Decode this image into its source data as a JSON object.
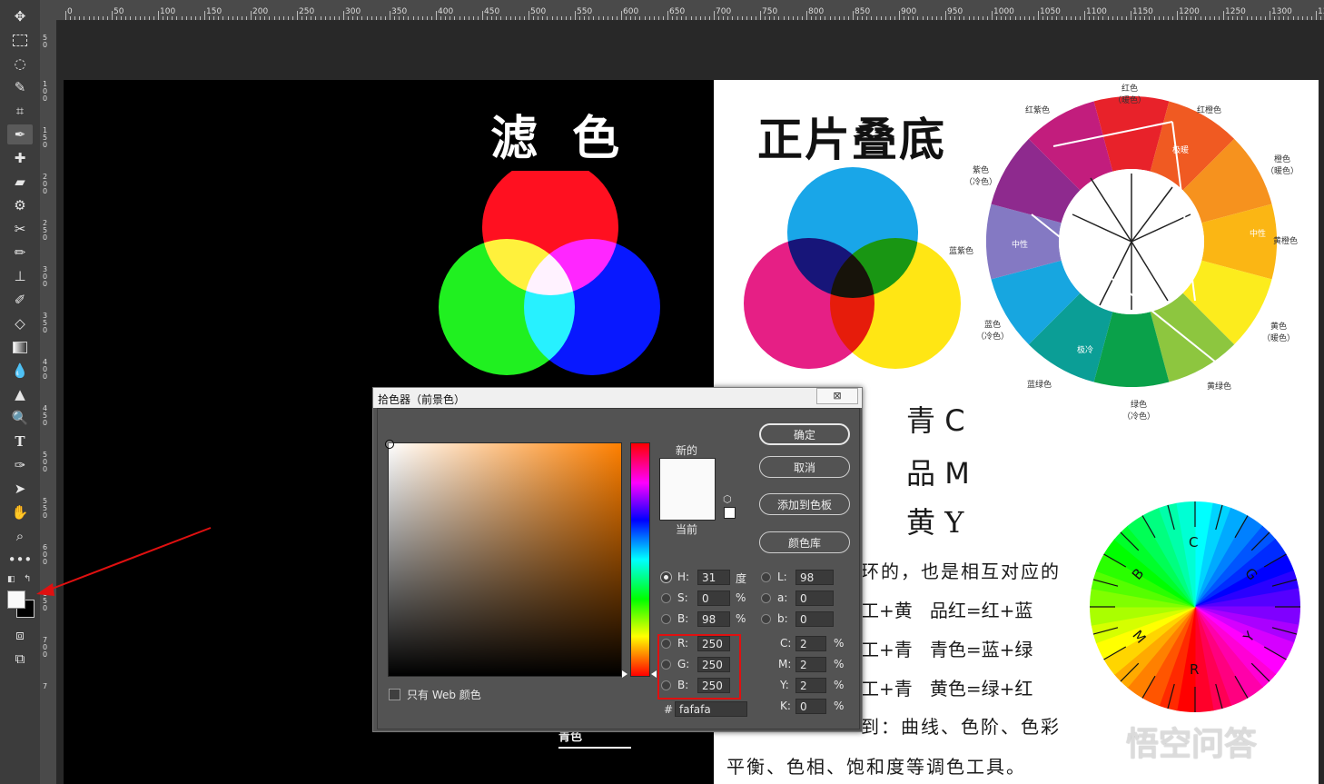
{
  "ruler": {
    "h_labels": [
      "0",
      "50",
      "100",
      "150",
      "200",
      "250",
      "300",
      "350",
      "400",
      "450",
      "500",
      "550",
      "600",
      "650",
      "700",
      "750",
      "800",
      "850",
      "900",
      "950",
      "1000",
      "1050",
      "1100",
      "1150",
      "1200",
      "1250",
      "1300",
      "13"
    ],
    "v_labels": [
      "5 0",
      "1 0 0",
      "1 5 0",
      "2 0 0",
      "2 5 0",
      "3 0 0",
      "3 5 0",
      "4 0 0",
      "4 5 0",
      "5 0 0",
      "5 5 0",
      "6 0 0",
      "6 5 0",
      "7 0 0",
      "7"
    ]
  },
  "tools": [
    "move-icon",
    "marquee-icon",
    "lasso-icon",
    "quick-select-icon",
    "crop-icon",
    "eyedropper-icon",
    "healing-icon",
    "bandage-icon",
    "frame-icon",
    "transform-icon",
    "brush-icon",
    "stamp-icon",
    "history-brush-icon",
    "eraser-icon",
    "gradient-icon",
    "blur-icon",
    "sharpen-icon",
    "dodge-icon",
    "type-icon",
    "pen-icon",
    "path-select-icon",
    "hand-icon",
    "zoom-icon",
    "more-icon"
  ],
  "left_image": {
    "title": "滤 色"
  },
  "right_image": {
    "title": "正片叠底",
    "cmy": [
      {
        "hanzi": "青",
        "letter": "C"
      },
      {
        "hanzi": "品",
        "letter": "M"
      },
      {
        "hanzi": "黄",
        "letter": "Y"
      }
    ],
    "wheel_labels": {
      "top": "红色\n（暖色）",
      "red_purple": "红紫色",
      "red_orange": "红橙色",
      "purple": "紫色\n（冷色）",
      "orange": "橙色\n（暖色）",
      "blue_purple": "蓝紫色",
      "yellow_orange": "黄橙色",
      "blue": "蓝色\n（冷色）",
      "yellow": "黄色\n（暖色）",
      "blue_green": "蓝绿色",
      "yellow_green": "黄绿色",
      "green": "绿色\n（冷色）",
      "inner_warm": "极暖",
      "inner_cold": "极冷",
      "inner_neutral_left": "中性",
      "inner_neutral_right": "中性"
    },
    "wheel2_letters": [
      "C",
      "G",
      "Y",
      "R",
      "M",
      "B"
    ],
    "text_lines": [
      "环的，也是相互对应的",
      "工+黄   品红=红+蓝",
      "工+青   青色=蓝+绿",
      "工+青   黄色=绿+红",
      "到：曲线、色阶、色彩",
      "平衡、色相、饱和度等调色工具。"
    ],
    "watermark": "悟空问答"
  },
  "partial_label": "青色",
  "dialog": {
    "title": "拾色器（前景色）",
    "close": "⊠",
    "new_label": "新的",
    "current_label": "当前",
    "buttons": {
      "ok": "确定",
      "cancel": "取消",
      "add_swatch": "添加到色板",
      "library": "颜色库"
    },
    "web_only_label": "只有 Web 颜色",
    "hsb": [
      {
        "key": "H:",
        "value": "31",
        "unit": "度",
        "checked": true
      },
      {
        "key": "S:",
        "value": "0",
        "unit": "%",
        "checked": false
      },
      {
        "key": "B:",
        "value": "98",
        "unit": "%",
        "checked": false
      }
    ],
    "rgb": [
      {
        "key": "R:",
        "value": "250"
      },
      {
        "key": "G:",
        "value": "250"
      },
      {
        "key": "B:",
        "value": "250"
      }
    ],
    "lab": [
      {
        "key": "L:",
        "value": "98"
      },
      {
        "key": "a:",
        "value": "0"
      },
      {
        "key": "b:",
        "value": "0"
      }
    ],
    "cmyk": [
      {
        "key": "C:",
        "value": "2",
        "unit": "%"
      },
      {
        "key": "M:",
        "value": "2",
        "unit": "%"
      },
      {
        "key": "Y:",
        "value": "2",
        "unit": "%"
      },
      {
        "key": "K:",
        "value": "0",
        "unit": "%"
      }
    ],
    "hex_label": "#",
    "hex": "fafafa",
    "colors": {
      "new": "#fafafa",
      "current": "#fafafa",
      "hue": "#ff8000"
    }
  }
}
